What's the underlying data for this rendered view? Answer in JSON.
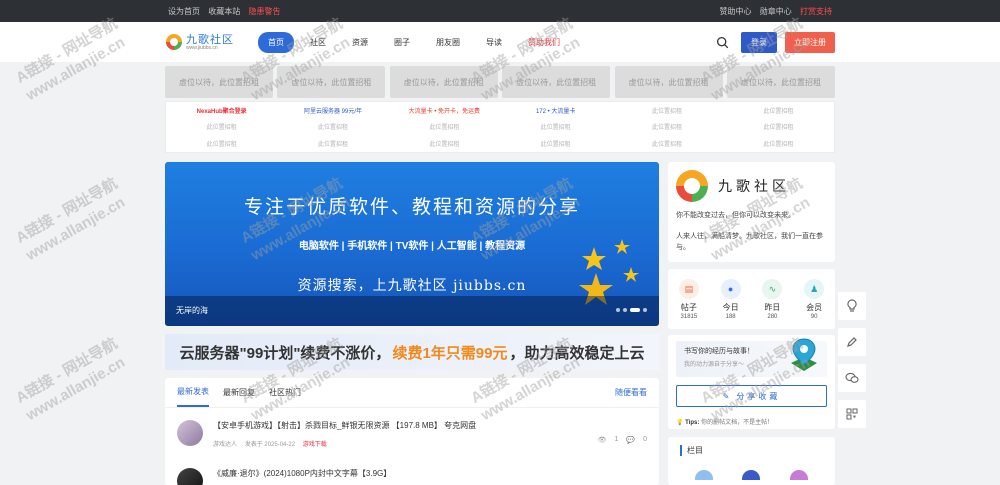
{
  "topbar": {
    "left": [
      "设为首页",
      "收藏本站"
    ],
    "left_highlight": "隐患警告",
    "right": [
      "赞助中心",
      "勋章中心"
    ],
    "right_highlight": "打赏支持"
  },
  "header": {
    "logo_name": "九歌社区",
    "logo_url": "www.jiubbs.cn",
    "nav": [
      {
        "label": "首页",
        "active": true
      },
      {
        "label": "社区"
      },
      {
        "label": "资源"
      },
      {
        "label": "圈子"
      },
      {
        "label": "朋友圈"
      },
      {
        "label": "导读"
      },
      {
        "label": "赞助我们",
        "red": true
      }
    ],
    "login_label": "登录",
    "register_label": "立即注册"
  },
  "ad_slots": [
    "虚位以待，此位置招租",
    "虚位以待，此位置招租",
    "虚位以待，此位置招租",
    "虚位以待，此位置招租",
    "虚位以待，此位置招租",
    "虚位以待，此位置招租"
  ],
  "link_grid": [
    {
      "text": "NexaHub聚合登录",
      "style": "red"
    },
    {
      "text": "阿里云服务器 99元/年",
      "style": "blue"
    },
    {
      "text": "大流量卡 • 免开卡，免运费",
      "style": "darkred"
    },
    {
      "text": "172 • 大流量卡",
      "style": "blue"
    },
    {
      "text": "此位置招租"
    },
    {
      "text": "此位置招租"
    },
    {
      "text": "此位置招租"
    },
    {
      "text": "此位置招租"
    },
    {
      "text": "此位置招租"
    },
    {
      "text": "此位置招租"
    },
    {
      "text": "此位置招租"
    },
    {
      "text": "此位置招租"
    },
    {
      "text": "此位置招租"
    },
    {
      "text": "此位置招租"
    },
    {
      "text": "此位置招租"
    },
    {
      "text": "此位置招租"
    },
    {
      "text": "此位置招租"
    },
    {
      "text": "此位置招租"
    }
  ],
  "banner": {
    "headline": "专注于优质软件、教程和资源的分享",
    "categories": "电脑软件 | 手机软件 | TV软件 | 人工智能 | 教程资源",
    "search_line": "资源搜索，上九歌社区 jiubbs.cn",
    "caption": "无岸的海"
  },
  "promo": {
    "part1": "云服务器\"99计划\"续费不涨价，",
    "part2": "续费1年只需99元",
    "part3": "，助力高效稳定上云"
  },
  "posts": {
    "tabs": [
      "最新发表",
      "最新回复",
      "社区热门"
    ],
    "more_label": "随便看看",
    "items": [
      {
        "title": "【安卓手机游戏】【射击】杀戮目标_鲜银无限资源 【197.8 MB】 夸克网盘",
        "author": "游戏达人",
        "date": "发表于 2025-04-22",
        "tag": "游戏下载",
        "views": "1",
        "replies": "0"
      },
      {
        "title": "《威廉·退尔》(2024)1080P内封中文字幕【3.9G】",
        "author": "",
        "date": "",
        "tag": "",
        "views": "",
        "replies": ""
      }
    ]
  },
  "sidebar": {
    "about_name": "九歌社区",
    "about_line1": "你不能改变过去，但你可以改变未来。",
    "about_line2": "人来人往，满船清梦。九歌社区，我们一直在参与。",
    "stats": [
      {
        "label": "帖子",
        "value": "31815",
        "color": "#fdeee8",
        "fg": "#f06a3c"
      },
      {
        "label": "今日",
        "value": "188",
        "color": "#e8effd",
        "fg": "#3a6fe0"
      },
      {
        "label": "昨日",
        "value": "280",
        "color": "#e7f6ee",
        "fg": "#2eaa6a"
      },
      {
        "label": "会员",
        "value": "90",
        "color": "#e6f6f7",
        "fg": "#2aa6b4"
      }
    ],
    "write_title": "书写你的经历与故事！",
    "write_sub": "我的动力源自于分享～",
    "share_label": "分享收藏",
    "tips_label": "Tips:",
    "tips_text": "你的删帖文档，不是主帖！",
    "column_title": "栏目"
  },
  "watermark_text": "A链接 - 网址导航",
  "watermark_url": "www.allanjie.cn"
}
